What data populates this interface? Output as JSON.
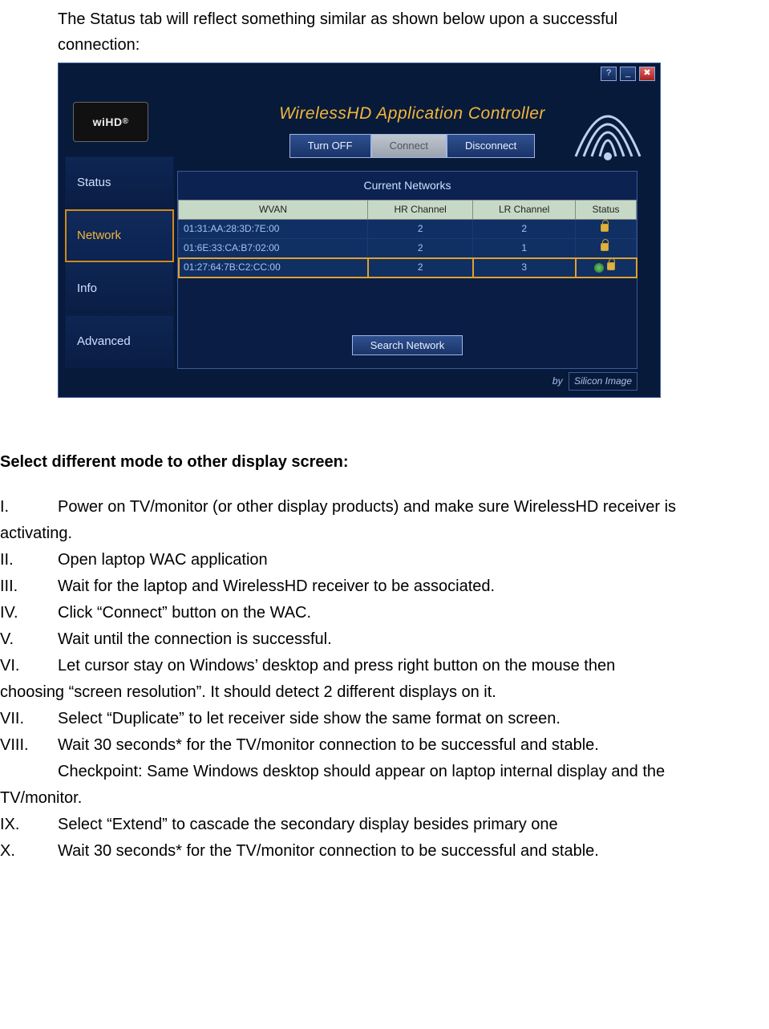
{
  "intro": "The Status tab will reflect something similar as shown below upon a successful connection:",
  "app": {
    "logo_label": "wiHD",
    "title": "WirelessHD Application Controller",
    "buttons": {
      "turnoff": "Turn OFF",
      "connect": "Connect",
      "disconnect": "Disconnect"
    },
    "tabs": {
      "status": "Status",
      "network": "Network",
      "info": "Info",
      "advanced": "Advanced"
    },
    "networks_title": "Current Networks",
    "columns": {
      "wvan": "WVAN",
      "hr": "HR Channel",
      "lr": "LR Channel",
      "status": "Status"
    },
    "rows": [
      {
        "wvan": "01:31:AA:28:3D:7E:00",
        "hr": "2",
        "lr": "2",
        "selected": false,
        "sound": false
      },
      {
        "wvan": "01:6E:33:CA:B7:02:00",
        "hr": "2",
        "lr": "1",
        "selected": false,
        "sound": false
      },
      {
        "wvan": "01:27:64:7B:C2:CC:00",
        "hr": "2",
        "lr": "3",
        "selected": true,
        "sound": true
      }
    ],
    "search_label": "Search Network",
    "by_label": "by",
    "brand": "Silicon Image"
  },
  "heading": "Select different mode to other display screen:",
  "steps": {
    "n1": "I.",
    "t1": "Power on TV/monitor (or other display products) and make sure WirelessHD receiver is",
    "t1b": "activating.",
    "n2": "II.",
    "t2": "Open laptop WAC application",
    "n3": "III.",
    "t3": "Wait for the laptop and WirelessHD receiver to be associated.",
    "n4": "IV.",
    "t4": "Click “Connect” button on the WAC.",
    "n5": "V.",
    "t5": "Wait until the connection is successful.",
    "n6": "VI.",
    "t6": "Let cursor stay on Windows’ desktop and press right button on the mouse then",
    "t6b": "choosing “screen resolution”. It should detect 2 different displays on it.",
    "n7": "VII.",
    "t7": "Select “Duplicate” to let receiver side show the same format on screen.",
    "n8": "VIII.",
    "t8": "Wait 30 seconds* for the TV/monitor connection to be successful and stable.",
    "t8b": "Checkpoint: Same Windows desktop should appear on laptop internal display and the",
    "t8c": "TV/monitor.",
    "n9": "IX.",
    "t9": "Select “Extend” to cascade the secondary display besides primary one",
    "n10": "X.",
    "t10": "Wait 30 seconds* for the TV/monitor connection to be successful and stable."
  }
}
